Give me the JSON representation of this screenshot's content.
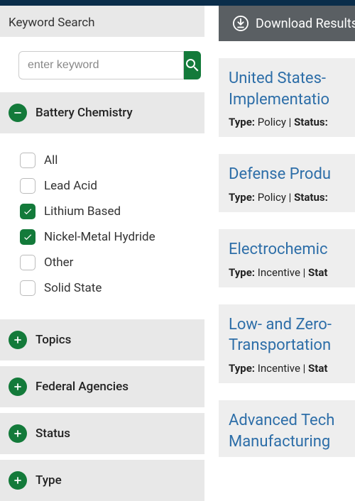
{
  "sidebar": {
    "keyword_header": "Keyword Search",
    "search_placeholder": "enter keyword",
    "facets": {
      "battery_chemistry": {
        "label": "Battery Chemistry",
        "expanded": true,
        "options": [
          {
            "label": "All",
            "checked": false
          },
          {
            "label": "Lead Acid",
            "checked": false
          },
          {
            "label": "Lithium Based",
            "checked": true
          },
          {
            "label": "Nickel-Metal Hydride",
            "checked": true
          },
          {
            "label": "Other",
            "checked": false
          },
          {
            "label": "Solid State",
            "checked": false
          }
        ]
      },
      "topics": {
        "label": "Topics",
        "expanded": false
      },
      "federal_agencies": {
        "label": "Federal Agencies",
        "expanded": false
      },
      "status": {
        "label": "Status",
        "expanded": false
      },
      "type": {
        "label": "Type",
        "expanded": false
      }
    }
  },
  "download_label": "Download Results",
  "results": [
    {
      "title_line1": "United States-",
      "title_line2": "Implementatio",
      "type_label": "Type:",
      "type_value": "Policy",
      "status_label": "Status:"
    },
    {
      "title_line1": "Defense Produ",
      "type_label": "Type:",
      "type_value": "Policy",
      "status_label": "Status:"
    },
    {
      "title_line1": "Electrochemic",
      "type_label": "Type:",
      "type_value": "Incentive",
      "status_label": "Stat"
    },
    {
      "title_line1": "Low- and Zero-",
      "title_line2": "Transportation",
      "type_label": "Type:",
      "type_value": "Incentive",
      "status_label": "Stat"
    },
    {
      "title_line1": "Advanced Tech",
      "title_line2": "Manufacturing"
    }
  ]
}
